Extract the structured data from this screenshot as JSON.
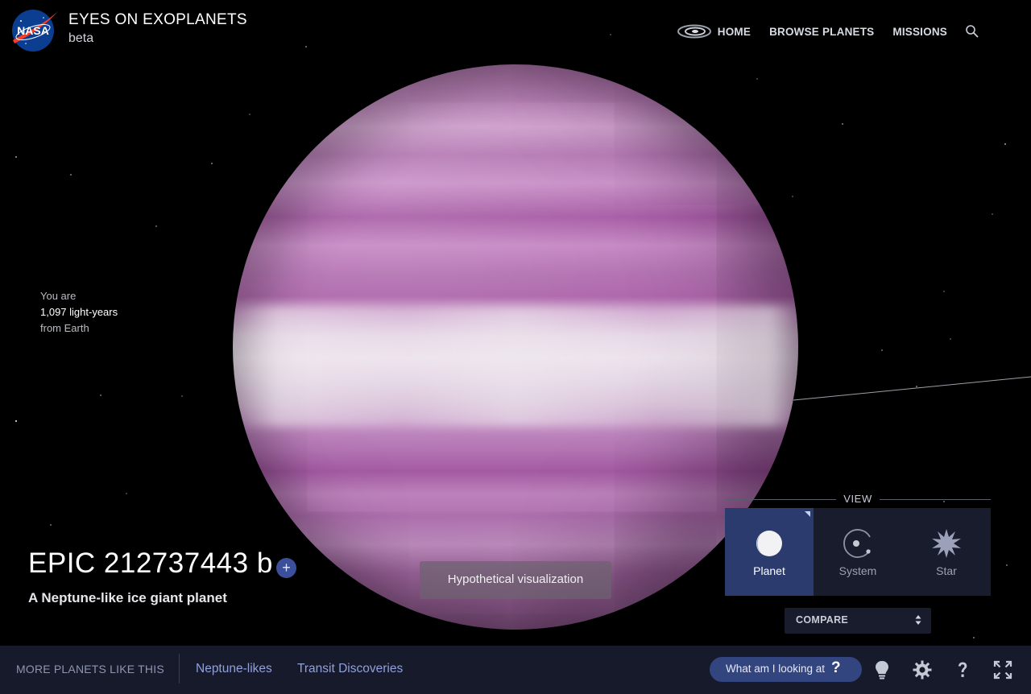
{
  "header": {
    "title": "EYES ON EXOPLANETS",
    "subtitle": "beta",
    "logo_text": "NASA",
    "nav": {
      "home": "HOME",
      "browse": "BROWSE PLANETS",
      "missions": "MISSIONS"
    }
  },
  "distance": {
    "line1": "You are",
    "line2": "1,097 light-years",
    "line3": "from Earth"
  },
  "planet": {
    "name": "EPIC 212737443 b",
    "add_symbol": "+",
    "description": "A Neptune-like ice giant planet",
    "badge": "Hypothetical visualization"
  },
  "view": {
    "label": "VIEW",
    "options": [
      {
        "label": "Planet",
        "active": true
      },
      {
        "label": "System",
        "active": false
      },
      {
        "label": "Star",
        "active": false
      }
    ],
    "compare_label": "COMPARE"
  },
  "bottombar": {
    "more_label": "MORE PLANETS LIKE THIS",
    "link1": "Neptune-likes",
    "link2": "Transit Discoveries",
    "what_label": "What am I looking at",
    "what_symbol": "?"
  },
  "colors": {
    "accent": "#33457f",
    "active_view": "#2b3b6e",
    "panel": "#191c2d",
    "bar": "#171a2b",
    "link": "#8fa0dd"
  }
}
